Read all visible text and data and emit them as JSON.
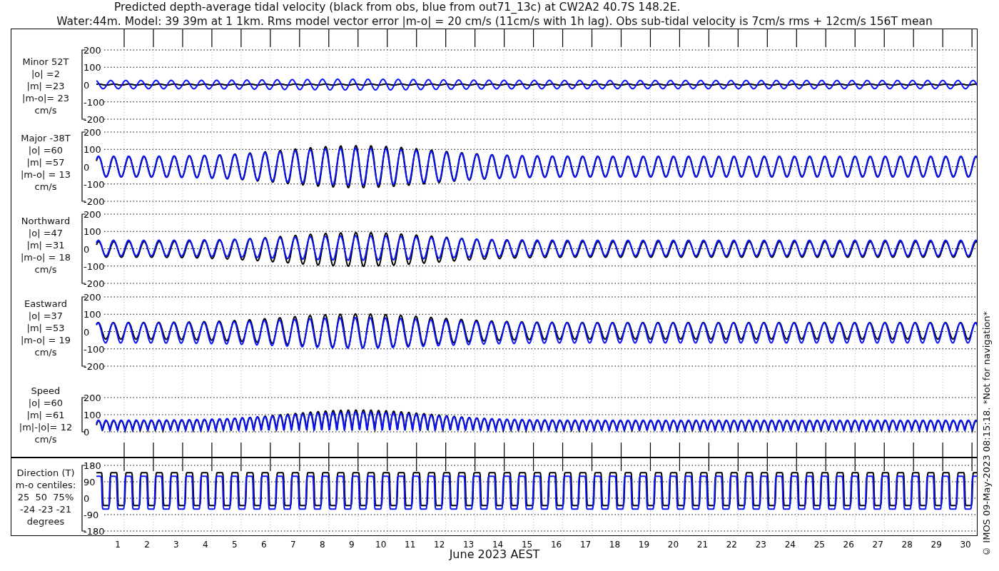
{
  "title": [
    "Predicted depth-average tidal velocity (black from obs, blue from out71_13c) at CW2A2 40.7S 148.2E.",
    "Water:44m. Model: 39 39m at 1 1km. Rms model vector error |m-o| = 20 cm/s (11cm/s with 1h lag). Obs sub-tidal velocity is 7cm/s rms + 12cm/s 156T mean"
  ],
  "panels": [
    {
      "kind": "velocity",
      "label": [
        "Minor 52T",
        "|o| =2",
        "|m| =23",
        "|m-o|= 23",
        "cm/s"
      ],
      "yticks": [
        "200",
        "100",
        "0",
        "-100",
        "-200"
      ]
    },
    {
      "kind": "velocity",
      "label": [
        "Major -38T",
        "|o| =60",
        "|m| =57",
        "|m-o| = 13",
        "cm/s"
      ],
      "yticks": [
        "200",
        "100",
        "0",
        "-100",
        "-200"
      ]
    },
    {
      "kind": "velocity",
      "label": [
        "Northward",
        "|o| =47",
        "|m| =31",
        "|m-o| = 18",
        "cm/s"
      ],
      "yticks": [
        "200",
        "100",
        "0",
        "-100",
        "-200"
      ]
    },
    {
      "kind": "velocity",
      "label": [
        "Eastward",
        "|o| =37",
        "|m| =53",
        "|m-o| = 19",
        "cm/s"
      ],
      "yticks": [
        "200",
        "100",
        "0",
        "-100",
        "-200"
      ]
    },
    {
      "kind": "speed",
      "label": [
        "Speed",
        "|o| =60",
        "|m| =61",
        "|m|-|o|= 12",
        "cm/s"
      ],
      "yticks": [
        "200",
        "100",
        "0"
      ]
    },
    {
      "kind": "direction",
      "label": [
        "Direction (T)",
        "m-o centiles:",
        "25  50  75%",
        "-24 -23 -21",
        "degrees"
      ],
      "yticks": [
        "180",
        "90",
        "0",
        "-90",
        "-180"
      ]
    }
  ],
  "x_axis": {
    "ticks": [
      "1",
      "2",
      "3",
      "4",
      "5",
      "6",
      "7",
      "8",
      "9",
      "10",
      "11",
      "12",
      "13",
      "14",
      "15",
      "16",
      "17",
      "18",
      "19",
      "20",
      "21",
      "22",
      "23",
      "24",
      "25",
      "26",
      "27",
      "28",
      "29",
      "30"
    ],
    "label": "June 2023 AEST"
  },
  "side_note": "© IMOS 09-May-2023 08:15:18.  *Not for navigation*"
}
